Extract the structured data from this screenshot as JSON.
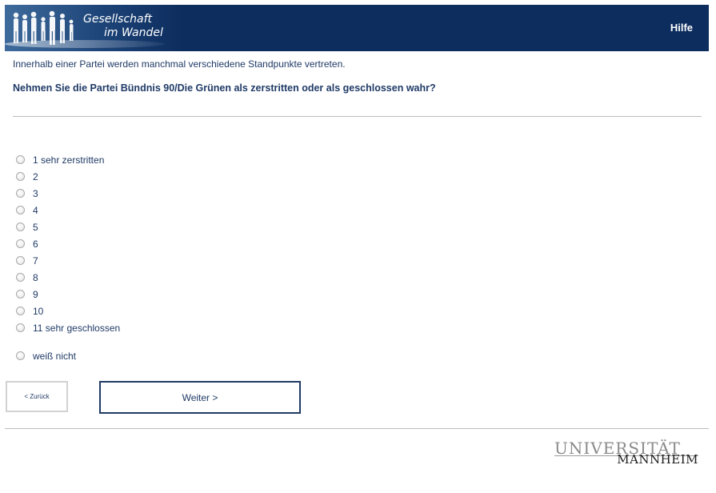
{
  "header": {
    "logo_line1": "Gesellschaft",
    "logo_line2": "im Wandel",
    "help_label": "Hilfe"
  },
  "survey": {
    "intro": "Innerhalb einer Partei werden manchmal verschiedene Standpunkte vertreten.",
    "question": "Nehmen Sie die Partei Bündnis 90/Die Grünen als zerstritten oder als geschlossen wahr?",
    "options": [
      "1 sehr zerstritten",
      "2",
      "3",
      "4",
      "5",
      "6",
      "7",
      "8",
      "9",
      "10",
      "11 sehr geschlossen"
    ],
    "dont_know": "weiß nicht"
  },
  "navigation": {
    "back_label": "< Zurück",
    "next_label": "Weiter >"
  },
  "footer": {
    "logo_line1": "UNIVERSITÄT",
    "logo_line2": "MANNHEIM"
  },
  "colors": {
    "header_bg": "#0d2d5e",
    "text_primary": "#1f3a66"
  }
}
